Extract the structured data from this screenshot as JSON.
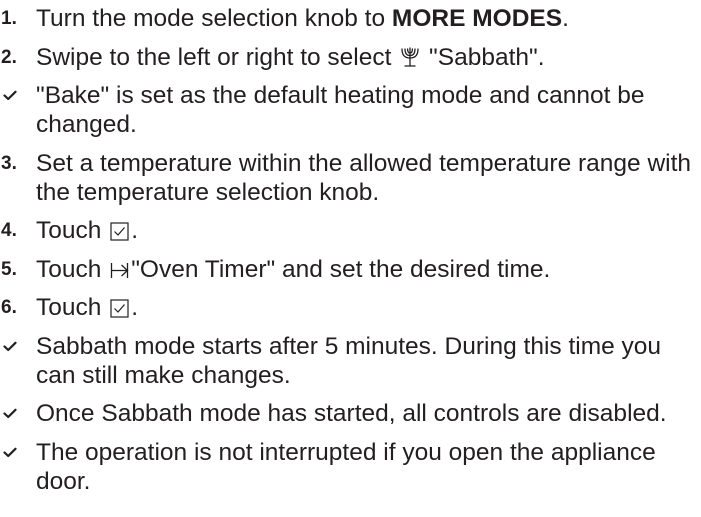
{
  "steps": [
    {
      "kind": "numbered",
      "number": "1.",
      "text_before": "Turn the mode selection knob to ",
      "bold": "MORE MODES",
      "text_after": "."
    },
    {
      "kind": "numbered",
      "number": "2.",
      "text_before": "Swipe to the left or right to select ",
      "icon": "menorah-icon",
      "text_after": " \"Sabbath\"."
    },
    {
      "kind": "result",
      "icon": "checkmark-icon",
      "text": "\"Bake\" is set as the default heating mode and cannot be changed."
    },
    {
      "kind": "numbered",
      "number": "3.",
      "text": "Set a temperature within the allowed temperature range with the temperature selection knob."
    },
    {
      "kind": "numbered",
      "number": "4.",
      "text_before": "Touch ",
      "icon": "confirm-checkbox-icon",
      "text_after": "."
    },
    {
      "kind": "numbered",
      "number": "5.",
      "text_before": "Touch ",
      "icon": "oven-timer-icon",
      "text_after": "\"Oven Timer\" and set the desired time."
    },
    {
      "kind": "numbered",
      "number": "6.",
      "text_before": "Touch ",
      "icon": "confirm-checkbox-icon",
      "text_after": "."
    },
    {
      "kind": "result",
      "icon": "checkmark-icon",
      "text": "Sabbath mode starts after 5 minutes. During this time you can still make changes."
    },
    {
      "kind": "result",
      "icon": "checkmark-icon",
      "text": "Once Sabbath mode has started, all controls are disabled."
    },
    {
      "kind": "result",
      "icon": "checkmark-icon",
      "text": "The operation is not interrupted if you open the appliance door."
    }
  ]
}
